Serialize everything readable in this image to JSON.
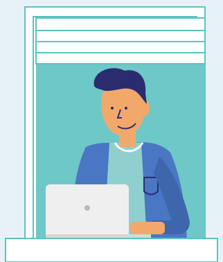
{
  "scene": {
    "description_hidden": "",
    "colors": {
      "wall": "#e6f2f7",
      "frame_outline": "#5cc4c0",
      "window_bg": "#6ec8c8",
      "frame_white": "#ffffff",
      "hair": "#2a2c6f",
      "skin": "#f2a86b",
      "shirt": "#8fd0cf",
      "jacket": "#4a77c3",
      "jacket_dark": "#3e66ad",
      "laptop": "#efefef",
      "laptop_dark": "#d7d7d7",
      "sill": "#ffffff"
    },
    "icons": [
      "window-frame",
      "window-blind",
      "person-with-laptop",
      "laptop-icon",
      "window-sill"
    ]
  }
}
